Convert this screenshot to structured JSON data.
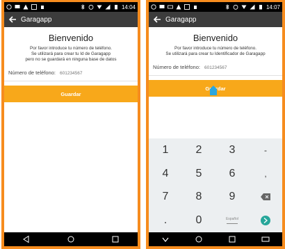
{
  "left": {
    "status": {
      "time": "14:04"
    },
    "appbar": {
      "title": "Garagapp"
    },
    "welcome": "Bienvenido",
    "description": [
      "Por favor introduce tu número de teléfono.",
      "Se utilizará para crear tu Id de Garagapp",
      "pero no se guardará en ninguna base de datos"
    ],
    "phone_label": "Número de teléfono:",
    "phone_placeholder": "601234567",
    "save_label": "Guardar"
  },
  "right": {
    "status": {
      "time": "14:07"
    },
    "appbar": {
      "title": "Garagapp"
    },
    "welcome": "Bienvenido",
    "description": [
      "Por favor introduce tu número de teléfono.",
      "Se utilizará para crear tu Identificador de Garagapp"
    ],
    "phone_label": "Número de teléfono:",
    "phone_placeholder": "601234567",
    "save_label": "Guardar",
    "keyboard": {
      "rows": [
        [
          "1",
          "2",
          "3",
          "-"
        ],
        [
          "4",
          "5",
          "6",
          ","
        ],
        [
          "7",
          "8",
          "9",
          "⌫"
        ],
        [
          ".",
          "0",
          "Español",
          "›"
        ]
      ]
    }
  },
  "colors": {
    "accent": "#f8a81a",
    "frame": "#f68c1e",
    "appbar": "#3c3c3c",
    "go": "#26a69a"
  }
}
